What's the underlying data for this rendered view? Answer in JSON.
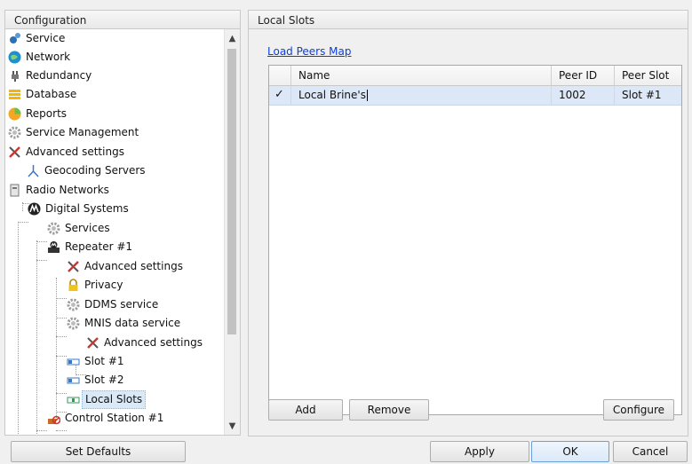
{
  "left_panel": {
    "title": "Configuration"
  },
  "tree": [
    {
      "label": "Service",
      "icon": "service-gears-icon"
    },
    {
      "label": "Network",
      "icon": "network-globe-icon"
    },
    {
      "label": "Redundancy",
      "icon": "redundancy-plug-icon"
    },
    {
      "label": "Database",
      "icon": "database-icon"
    },
    {
      "label": "Reports",
      "icon": "reports-icon"
    },
    {
      "label": "Service Management",
      "icon": "gear-icon"
    },
    {
      "label": "Advanced settings",
      "icon": "wrench-screwdriver-icon"
    },
    {
      "label": "Geocoding Servers",
      "icon": "geocoding-icon"
    },
    {
      "label": "Radio Networks",
      "icon": "radio-icon"
    },
    {
      "label": "Digital Systems",
      "icon": "motorola-logo-icon"
    },
    {
      "label": "Services",
      "icon": "gear-icon"
    },
    {
      "label": "Repeater #1",
      "icon": "repeater-icon"
    },
    {
      "label": "Advanced settings",
      "icon": "wrench-screwdriver-icon"
    },
    {
      "label": "Privacy",
      "icon": "lock-icon"
    },
    {
      "label": "DDMS service",
      "icon": "gear-icon"
    },
    {
      "label": "MNIS data service",
      "icon": "gear-icon"
    },
    {
      "label": "Advanced settings",
      "icon": "wrench-screwdriver-icon"
    },
    {
      "label": "Slot #1",
      "icon": "slot-icon"
    },
    {
      "label": "Slot #2",
      "icon": "slot-icon"
    },
    {
      "label": "Local Slots",
      "icon": "local-slots-icon"
    },
    {
      "label": "Control Station #1",
      "icon": "control-station-icon"
    }
  ],
  "right_panel": {
    "title": "Local Slots",
    "load_peers_link": "Load Peers Map",
    "columns": [
      "Name",
      "Peer ID",
      "Peer Slot"
    ],
    "rows": [
      {
        "checked": true,
        "name": "Local Brine's",
        "peer_id": "1002",
        "peer_slot": "Slot #1"
      }
    ],
    "buttons": {
      "add": "Add",
      "remove": "Remove",
      "configure": "Configure"
    }
  },
  "footer": {
    "set_defaults": "Set Defaults",
    "apply": "Apply",
    "ok": "OK",
    "cancel": "Cancel"
  },
  "colors": {
    "selection": "#dce8f7",
    "link": "#0b3fe0",
    "ok_border": "#6b9fd8"
  }
}
